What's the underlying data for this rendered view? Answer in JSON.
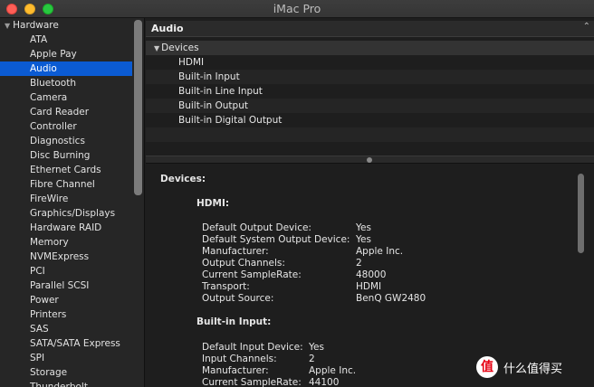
{
  "window": {
    "title": "iMac Pro"
  },
  "sidebar": {
    "group_label": "Hardware",
    "items": [
      {
        "label": "ATA"
      },
      {
        "label": "Apple Pay"
      },
      {
        "label": "Audio",
        "selected": true
      },
      {
        "label": "Bluetooth"
      },
      {
        "label": "Camera"
      },
      {
        "label": "Card Reader"
      },
      {
        "label": "Controller"
      },
      {
        "label": "Diagnostics"
      },
      {
        "label": "Disc Burning"
      },
      {
        "label": "Ethernet Cards"
      },
      {
        "label": "Fibre Channel"
      },
      {
        "label": "FireWire"
      },
      {
        "label": "Graphics/Displays"
      },
      {
        "label": "Hardware RAID"
      },
      {
        "label": "Memory"
      },
      {
        "label": "NVMExpress"
      },
      {
        "label": "PCI"
      },
      {
        "label": "Parallel SCSI"
      },
      {
        "label": "Power"
      },
      {
        "label": "Printers"
      },
      {
        "label": "SAS"
      },
      {
        "label": "SATA/SATA Express"
      },
      {
        "label": "SPI"
      },
      {
        "label": "Storage"
      },
      {
        "label": "Thunderbolt"
      }
    ]
  },
  "top_panel": {
    "header": "Audio",
    "group_label": "Devices",
    "devices": [
      "HDMI",
      "Built-in Input",
      "Built-in Line Input",
      "Built-in Output",
      "Built-in Digital Output"
    ]
  },
  "detail": {
    "heading": "Devices:",
    "sections": [
      {
        "name": "HDMI:",
        "props": [
          {
            "key": "Default Output Device:",
            "value": "Yes"
          },
          {
            "key": "Default System Output Device:",
            "value": "Yes"
          },
          {
            "key": "Manufacturer:",
            "value": "Apple Inc."
          },
          {
            "key": "Output Channels:",
            "value": "2"
          },
          {
            "key": "Current SampleRate:",
            "value": "48000"
          },
          {
            "key": "Transport:",
            "value": "HDMI"
          },
          {
            "key": "Output Source:",
            "value": "BenQ GW2480"
          }
        ]
      },
      {
        "name": "Built-in Input:",
        "props": [
          {
            "key": "Default Input Device:",
            "value": "Yes"
          },
          {
            "key": "Input Channels:",
            "value": "2"
          },
          {
            "key": "Manufacturer:",
            "value": "Apple Inc."
          },
          {
            "key": "Current SampleRate:",
            "value": "44100"
          }
        ]
      }
    ]
  },
  "watermark": {
    "logo": "值",
    "text": "什么值得买"
  }
}
